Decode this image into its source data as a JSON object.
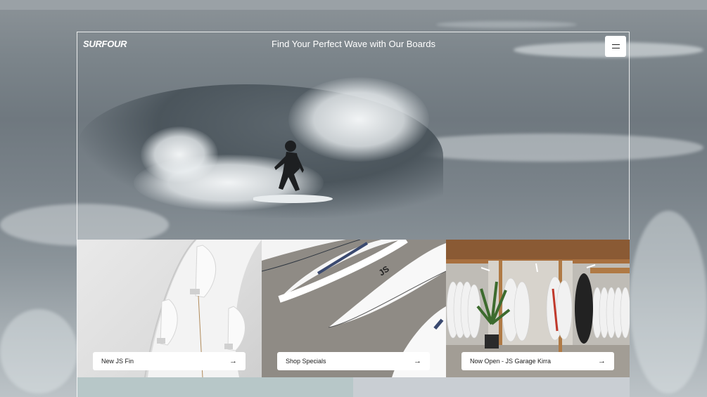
{
  "header": {
    "logo": "SURFOUR",
    "tagline": "Find Your Perfect Wave with Our Boards",
    "menu_icon": "hamburger-menu-icon"
  },
  "tiles": [
    {
      "label": "New JS Fin",
      "icon": "arrow-right-icon",
      "arrow": "→"
    },
    {
      "label": "Shop Specials",
      "icon": "arrow-right-icon",
      "arrow": "→"
    },
    {
      "label": "Now Open - JS Garage Kirra",
      "icon": "arrow-right-icon",
      "arrow": "→"
    }
  ],
  "colors": {
    "accent_white": "#ffffff",
    "panel_teal": "#b7c7c8",
    "panel_grey": "#c9ced3"
  }
}
